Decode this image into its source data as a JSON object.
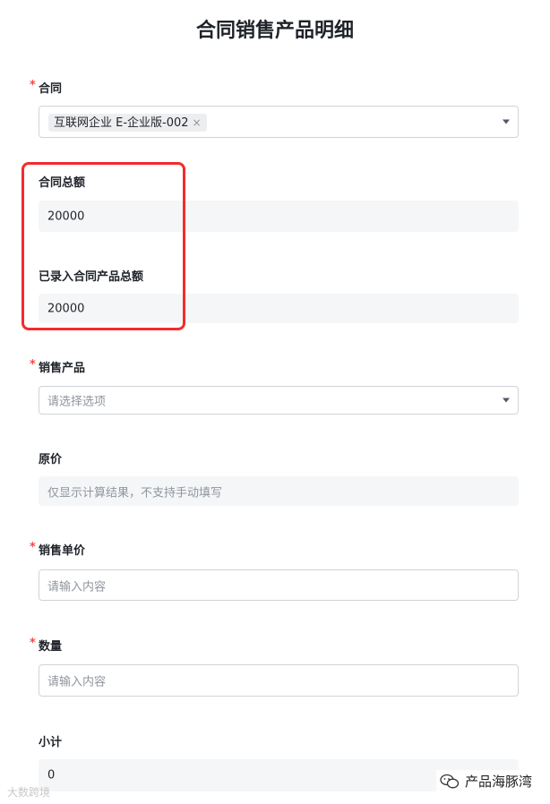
{
  "page": {
    "title": "合同销售产品明细"
  },
  "form": {
    "contract": {
      "label": "合同",
      "required_mark": "*",
      "tag_value": "互联网企业 E-企业版-002",
      "tag_remove": "×"
    },
    "contract_total": {
      "label": "合同总额",
      "value": "20000"
    },
    "entered_total": {
      "label": "已录入合同产品总额",
      "value": "20000"
    },
    "product": {
      "label": "销售产品",
      "required_mark": "*",
      "placeholder": "请选择选项"
    },
    "original_price": {
      "label": "原价",
      "placeholder": "仅显示计算结果，不支持手动填写"
    },
    "unit_price": {
      "label": "销售单价",
      "required_mark": "*",
      "placeholder": "请输入内容"
    },
    "quantity": {
      "label": "数量",
      "required_mark": "*",
      "placeholder": "请输入内容"
    },
    "subtotal": {
      "label": "小计",
      "value": "0"
    }
  },
  "watermarks": {
    "left": "大数跨境",
    "right": "产品海豚湾"
  },
  "colors": {
    "highlight": "#f22c2c",
    "required": "#f54a45"
  }
}
